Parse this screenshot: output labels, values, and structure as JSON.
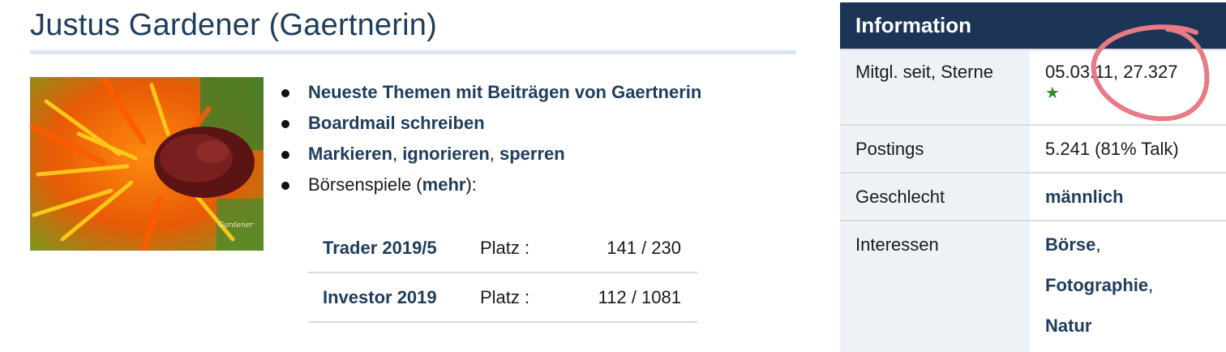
{
  "profile": {
    "title": "Justus Gardener (Gaertnerin)",
    "watermark": "Gardener"
  },
  "links": {
    "themen": "Neueste Themen mit Beiträgen von Gaertnerin",
    "boardmail": "Boardmail schreiben",
    "markieren": "Markieren",
    "sep1": ", ",
    "ignorieren": "ignorieren",
    "sep2": ", ",
    "sperren": "sperren",
    "boersenspiele_prefix": "Börsenspiele (",
    "mehr": "mehr",
    "boersenspiele_suffix": "):"
  },
  "games": [
    {
      "name": "Trader 2019/5",
      "platz_label": "Platz :",
      "score": "141 / 230"
    },
    {
      "name": "Investor 2019",
      "platz_label": "Platz :",
      "score": "112 / 1081"
    }
  ],
  "info": {
    "header": "Information",
    "rows": [
      {
        "key": "Mitgl. seit, Sterne",
        "value": "05.03.11, 27.327"
      },
      {
        "key": "Postings",
        "value": "5.241 (81% Talk)"
      },
      {
        "key": "Geschlecht",
        "value": "männlich"
      },
      {
        "key": "Interessen",
        "i1": "Börse",
        "i2": "Fotographie",
        "i3": "Natur",
        "comma": ","
      }
    ]
  },
  "icons": {
    "star": "star-icon"
  },
  "colors": {
    "header_bg": "#1c3557",
    "link": "#1f3d5c",
    "annotation": "#e87a84"
  }
}
